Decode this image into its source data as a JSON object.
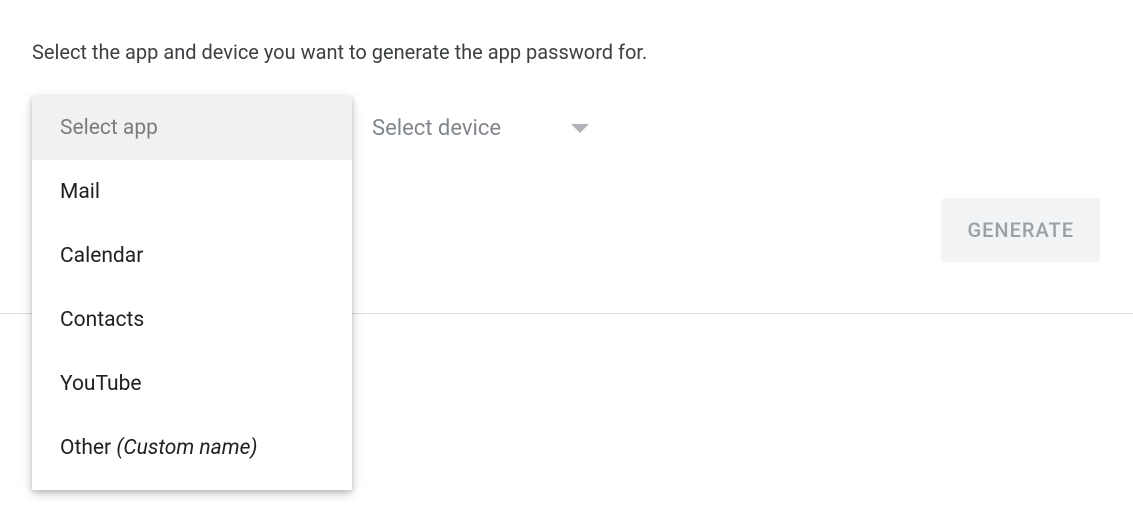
{
  "instruction": "Select the app and device you want to generate the app password for.",
  "selectApp": {
    "placeholder": "Select app",
    "options": [
      {
        "label": "Mail"
      },
      {
        "label": "Calendar"
      },
      {
        "label": "Contacts"
      },
      {
        "label": "YouTube"
      },
      {
        "label": "Other ",
        "suffixItalic": "(Custom name)"
      }
    ]
  },
  "selectDevice": {
    "placeholder": "Select device"
  },
  "generateButton": "GENERATE"
}
